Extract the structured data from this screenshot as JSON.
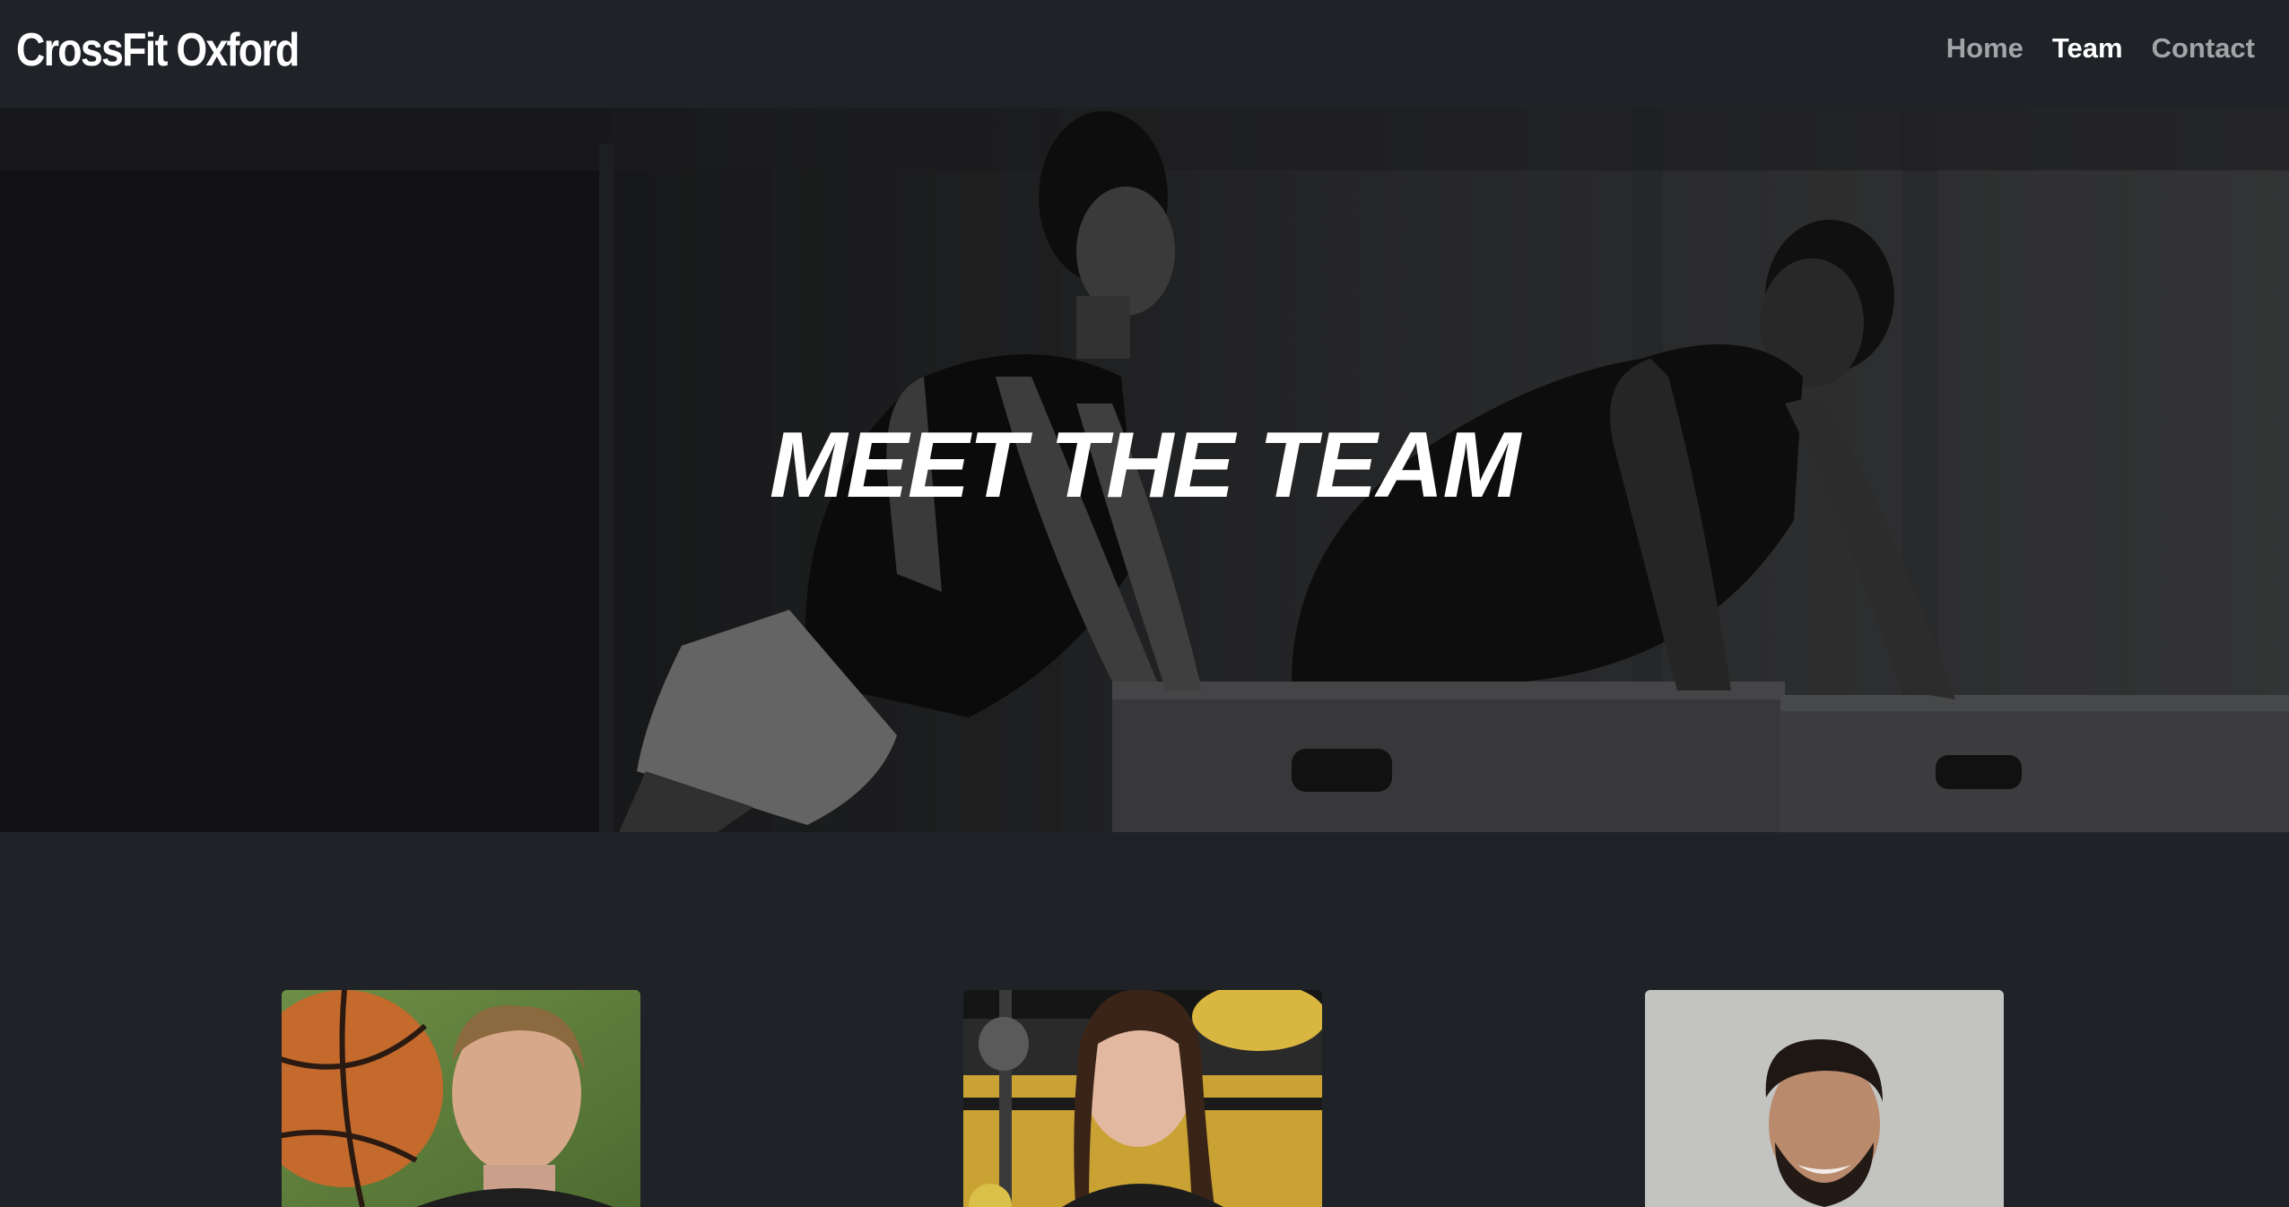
{
  "brand": {
    "name": "CrossFit Oxford"
  },
  "nav": {
    "items": [
      {
        "label": "Home",
        "active": false
      },
      {
        "label": "Team",
        "active": true
      },
      {
        "label": "Contact",
        "active": false
      }
    ]
  },
  "hero": {
    "title": "MEET THE TEAM",
    "image": "athletes-box-pushups-photo"
  },
  "team": {
    "members": [
      {
        "photo": "man-with-basketball-photo"
      },
      {
        "photo": "woman-in-gym-photo"
      },
      {
        "photo": "smiling-man-photo"
      }
    ]
  },
  "colors": {
    "background": "#1f2227",
    "text": "#ffffff",
    "nav_inactive": "#a2a4a8"
  }
}
